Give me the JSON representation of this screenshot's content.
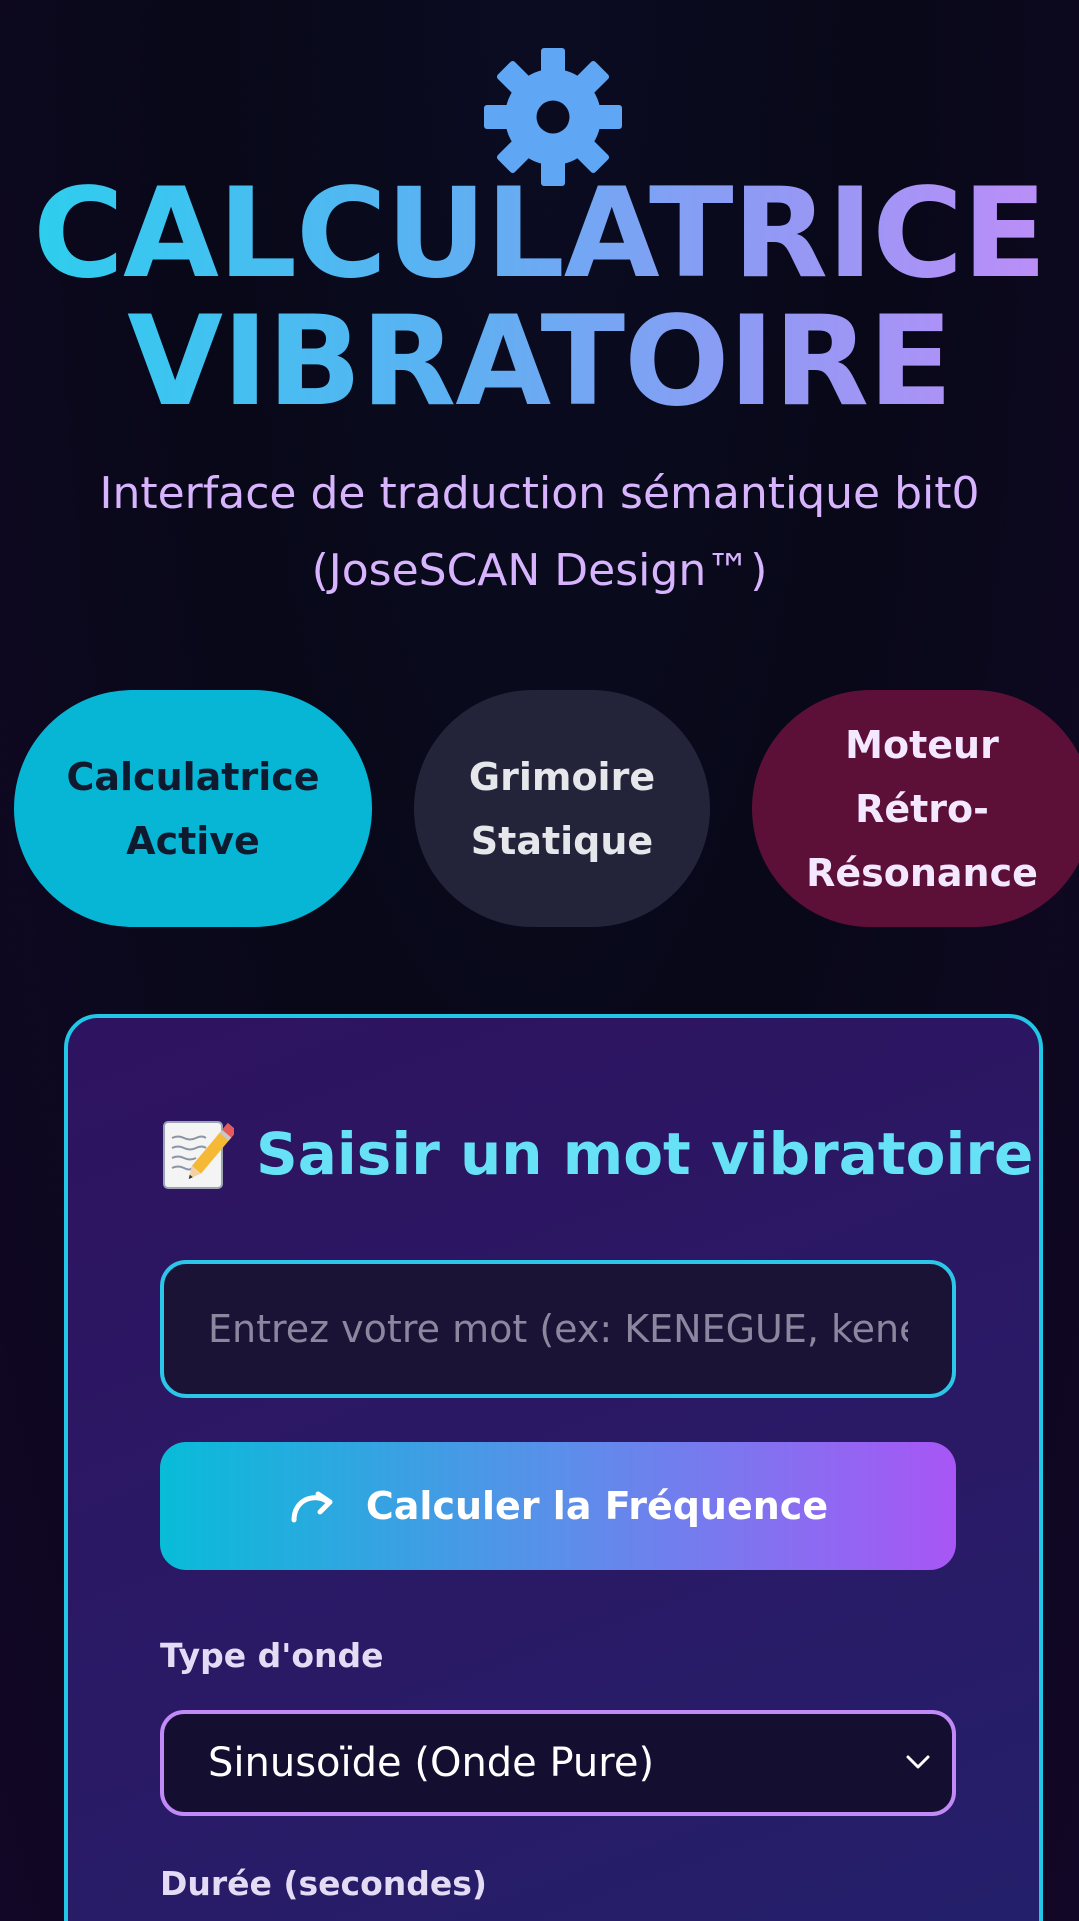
{
  "header": {
    "icon": "gear-icon",
    "title_line1": "CALCULATRICE",
    "title_line2": "VIBRATOIRE",
    "subtitle_line1": "Interface de traduction sémantique bit0",
    "subtitle_line2": "(JoseSCAN Design™)"
  },
  "tabs": [
    {
      "line1": "Calculatrice",
      "line2": "Active",
      "state": "active",
      "color": "#06b6d4"
    },
    {
      "line1": "Grimoire",
      "line2": "Statique",
      "color": "#23233a"
    },
    {
      "line1": "Moteur",
      "line2": "Rétro-",
      "line3": "Résonance",
      "color": "#5c1038"
    }
  ],
  "card": {
    "title_icon": "memo-icon",
    "title": "Saisir un mot vibratoire",
    "input": {
      "value": "",
      "placeholder": "Entrez votre mot (ex: KENEGUE, kenegue, Kenegue...)"
    },
    "button": {
      "icon": "redo-icon",
      "label": "Calculer la Fréquence"
    },
    "wave_type": {
      "label": "Type d'onde",
      "selected": "Sinusoïde (Onde Pure)"
    },
    "duration": {
      "label": "Durée (secondes)"
    }
  },
  "colors": {
    "accent_cyan": "#22c7e6",
    "accent_purple": "#a856f5",
    "background": "#080818"
  }
}
